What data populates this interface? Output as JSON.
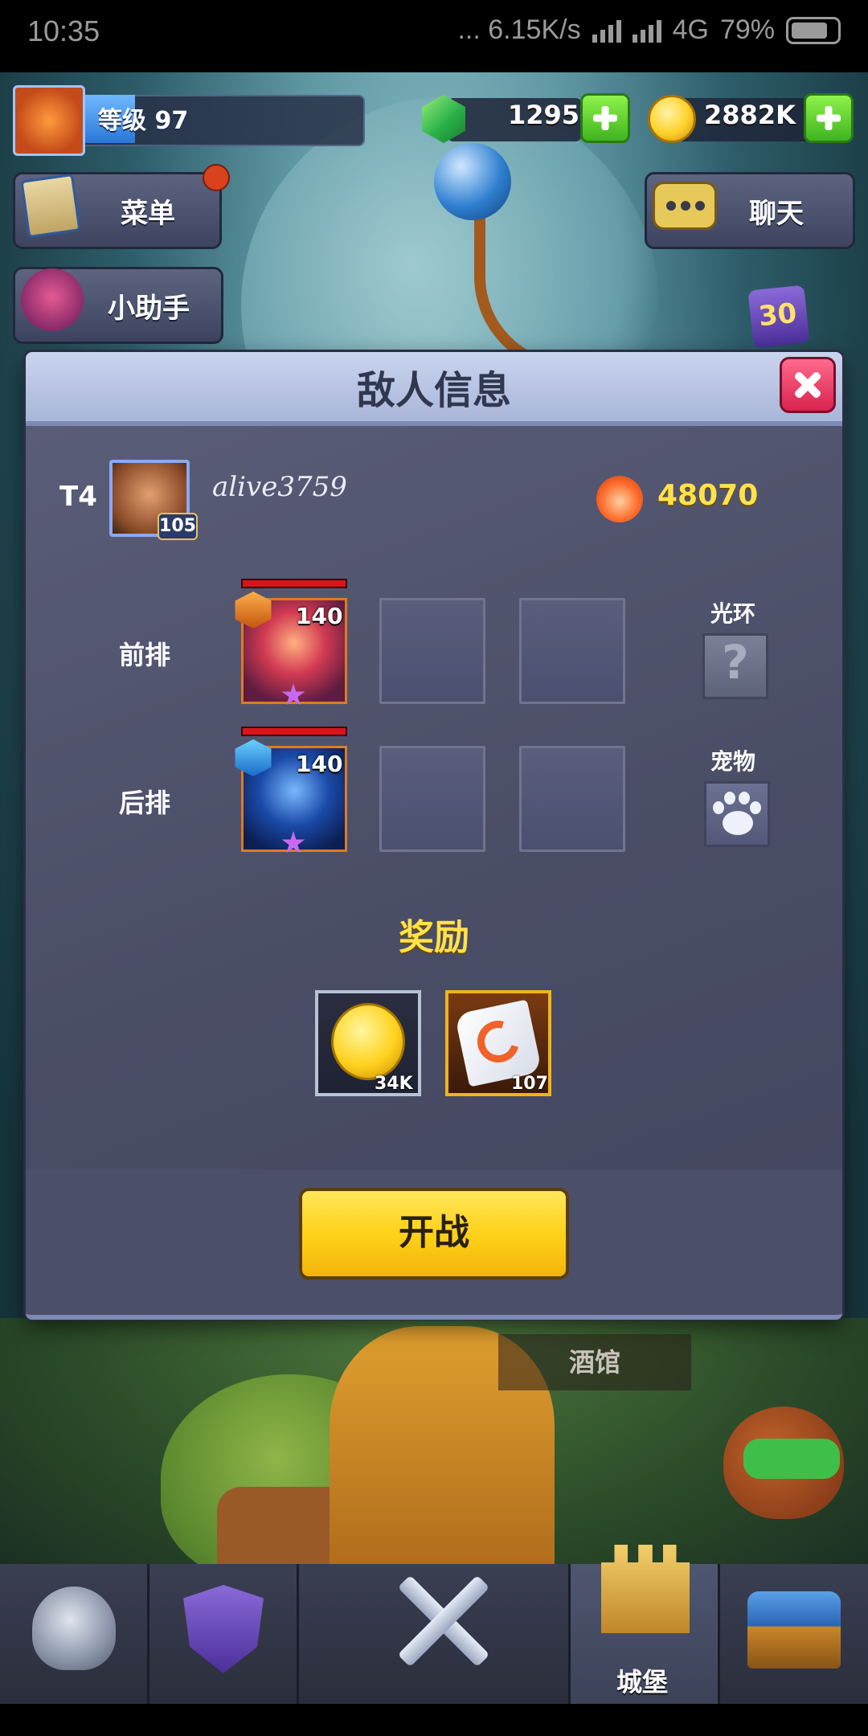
{
  "status_bar": {
    "time": "10:35",
    "network_speed": "... 6.15K/s",
    "network_type": "4G",
    "battery": "79%"
  },
  "hud": {
    "level_label": "等级 97",
    "gems": "1295",
    "gold": "2882K",
    "menu_label": "菜单",
    "helper_label": "小助手",
    "chat_label": "聊天",
    "event_badge": "30"
  },
  "modal": {
    "title": "敌人信息",
    "tier": "T4",
    "enemy_level": "105",
    "enemy_name": "alive3759",
    "power": "48070",
    "front_row_label": "前排",
    "back_row_label": "后排",
    "aura_label": "光环",
    "pet_label": "宠物",
    "heroes": [
      {
        "row": "front",
        "level": "140"
      },
      {
        "row": "back",
        "level": "140"
      }
    ],
    "reward_title": "奖励",
    "rewards": [
      {
        "item": "gold-coin",
        "qty": "34K"
      },
      {
        "item": "scroll",
        "qty": "107"
      }
    ],
    "start_button": "开战"
  },
  "scene": {
    "tavern_label": "酒馆"
  },
  "nav": {
    "active_label": "城堡"
  },
  "colors": {
    "accent_yellow": "#ffe24a",
    "close_red": "#d8234e",
    "plus_green": "#3fb41e"
  }
}
